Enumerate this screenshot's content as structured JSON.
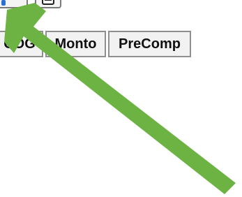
{
  "toolbar": {
    "buttons": [
      {
        "icon": "edit-icon"
      },
      {
        "icon": "document-icon"
      }
    ]
  },
  "tabs": [
    {
      "label": "COG"
    },
    {
      "label": "Monto"
    },
    {
      "label": "PreComp"
    }
  ],
  "overlay": {
    "arrow_icon": "pointer-arrow-icon",
    "arrow_color": "#6db344"
  }
}
